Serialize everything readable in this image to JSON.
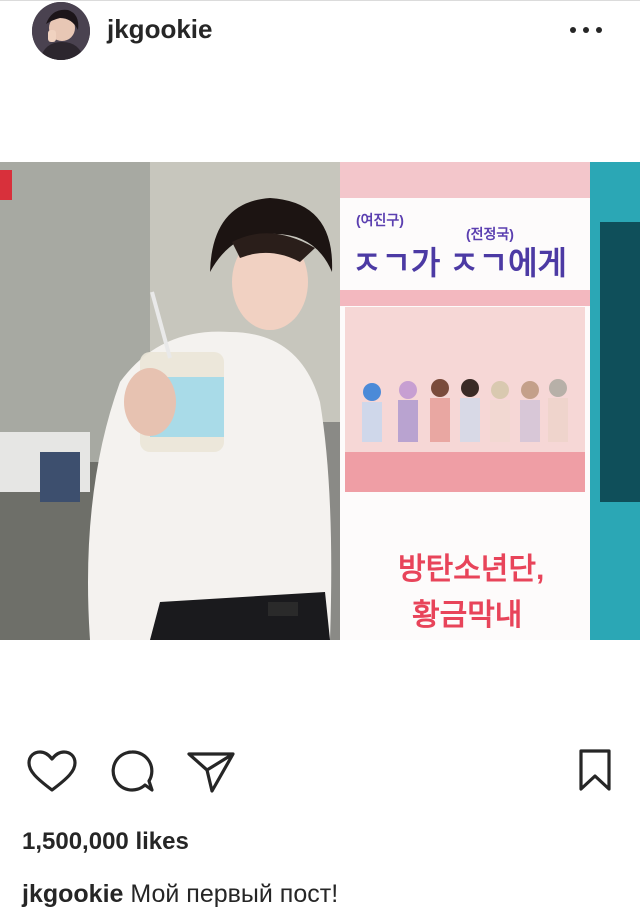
{
  "post": {
    "username": "jkgookie",
    "likes": "1,500,000 likes",
    "caption": "Мой первый пост!"
  },
  "photo_banner": {
    "top_label_left": "(여진구)",
    "top_label_right": "(전정국)",
    "heading": "ㅈㄱ가 ㅈㄱ에게",
    "footer_line1": "방탄소년단,",
    "footer_line2": "황금막내"
  },
  "icons": {
    "more": "more-dots-icon",
    "like": "heart-icon",
    "comment": "comment-icon",
    "share": "paper-plane-icon",
    "save": "bookmark-icon"
  },
  "colors": {
    "text": "#262626",
    "banner_pink": "#f3b8bf",
    "banner_text": "#e8445a",
    "teal": "#2ba7b5"
  }
}
